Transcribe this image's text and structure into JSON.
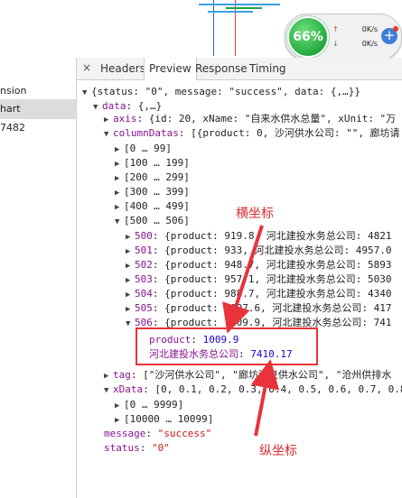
{
  "speed_widget": {
    "percent": "66%",
    "upload": "0K/s",
    "download": "0K/s",
    "plus": "+"
  },
  "sidebar": {
    "items": [
      {
        "label": "nsion"
      },
      {
        "label": "hart",
        "selected": true
      },
      {
        "label": "7482"
      }
    ]
  },
  "tabs": {
    "close": "×",
    "items": [
      "Headers",
      "Preview",
      "Response",
      "Timing"
    ],
    "active": "Preview"
  },
  "tree": {
    "root": "{status: \"0\", message: \"success\", data: {,…}}",
    "data_key": "data",
    "data_val": "{,…}",
    "axis_key": "axis",
    "axis_val": "{id: 20, xName: \"自来水供水总量\", xUnit: \"万",
    "columnDatas_key": "columnDatas",
    "columnDatas_val": "[{product: 0, 沙河供水公司: \"\", 廊坊请",
    "ranges": [
      "[0 … 99]",
      "[100 … 199]",
      "[200 … 299]",
      "[300 … 399]",
      "[400 … 499]"
    ],
    "range_open": "[500 … 506]",
    "rows": [
      {
        "idx": "500",
        "val": "{product: 919.8, 河北建投水务总公司: 4821"
      },
      {
        "idx": "501",
        "val": "{product: 933, 河北建投水务总公司: 4957.0"
      },
      {
        "idx": "502",
        "val": "{product: 948.7, 河北建投水务总公司: 5893"
      },
      {
        "idx": "503",
        "val": "{product: 957.1, 河北建投水务总公司: 5030"
      },
      {
        "idx": "504",
        "val": "{product: 988.7, 河北建投水务总公司: 4340"
      },
      {
        "idx": "505",
        "val": "{product: 1007.6, 河北建投水务总公司: 417"
      },
      {
        "idx": "506",
        "val": "{product: 1009.9, 河北建投水务总公司: 741"
      }
    ],
    "product_key": "product",
    "product_val": "1009.9",
    "company_key": "河北建投水务总公司",
    "company_val": "7410.17",
    "tag_key": "tag",
    "tag_val": "[\"沙河供水公司\", \"廊坊清泉供水公司\", \"沧州供排水",
    "xdata_key": "xData",
    "xdata_val": "[0, 0.1, 0.2, 0.3, 0.4, 0.5, 0.6, 0.7, 0.8",
    "xdata_ranges": [
      "[0 … 9999]",
      "[10000 … 10099]"
    ],
    "message_key": "message",
    "message_val": "\"success\"",
    "status_key": "status",
    "status_val": "\"0\""
  },
  "annotations": {
    "horizontal": "横坐标",
    "vertical": "纵坐标"
  },
  "colors": {
    "annotation_red": "#e8333a",
    "key_purple": "#881391",
    "string_red": "#c41a16",
    "number_blue": "#1c00cf"
  }
}
